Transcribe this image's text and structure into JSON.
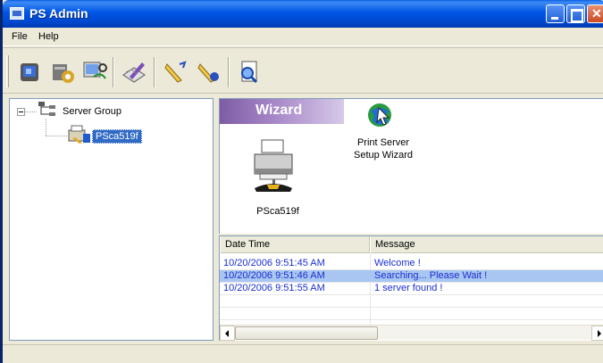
{
  "window": {
    "title": "PS Admin"
  },
  "menu": {
    "file": "File",
    "help": "Help"
  },
  "toolbar": {
    "buttons": [
      "computer-icon",
      "settings-icon",
      "search-network-icon",
      "configure-icon",
      "pen-icon",
      "pen-remove-icon",
      "properties-icon"
    ]
  },
  "tree": {
    "root_label": "Server Group",
    "child_label": "PSca519f"
  },
  "wizard": {
    "tab_label": "Wizard",
    "item_label_line1": "Print Server",
    "item_label_line2": "Setup Wizard",
    "printer_label": "PSca519f"
  },
  "log": {
    "columns": [
      "Date Time",
      "Message"
    ],
    "rows": [
      {
        "time": "10/20/2006 9:51:45 AM",
        "message": "Welcome !"
      },
      {
        "time": "10/20/2006 9:51:46 AM",
        "message": "Searching... Please Wait !"
      },
      {
        "time": "10/20/2006 9:51:55 AM",
        "message": "1 server found !"
      }
    ],
    "selected_row": 1
  },
  "colors": {
    "title_bar": "#0055e5",
    "selection": "#316ac5",
    "log_text": "#1a2fcf",
    "wizard_tab": "#7e5ca5"
  }
}
